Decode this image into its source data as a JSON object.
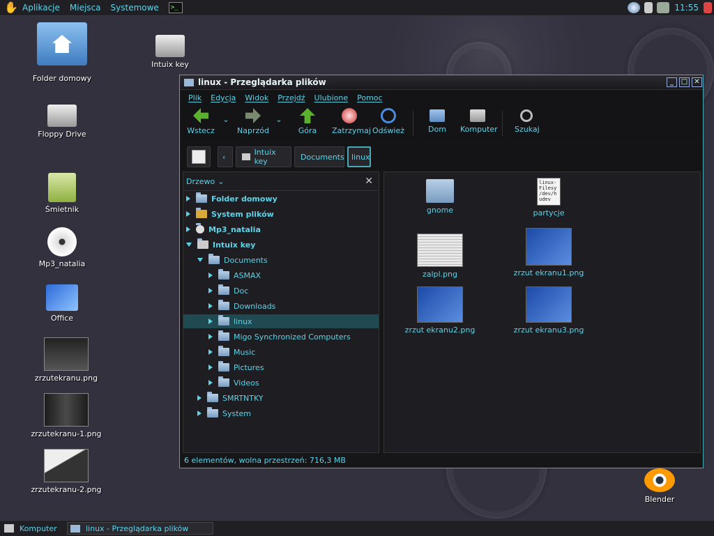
{
  "top_panel": {
    "menus": [
      "Aplikacje",
      "Miejsca",
      "Systemowe"
    ],
    "clock": "11:55",
    "tray_icons": [
      "globe-icon",
      "volume-icon",
      "battery-icon",
      "logout-icon"
    ]
  },
  "desktop_icons": [
    {
      "name": "home-folder",
      "label": "Folder domowy"
    },
    {
      "name": "floppy-drive",
      "label": "Floppy Drive"
    },
    {
      "name": "trash",
      "label": "Śmietnik"
    },
    {
      "name": "cd-mp3",
      "label": "Mp3_natalia"
    },
    {
      "name": "office",
      "label": "Office"
    },
    {
      "name": "screenshot",
      "label": "zrzutekranu.png"
    },
    {
      "name": "screenshot-1",
      "label": "zrzutekranu-1.png"
    },
    {
      "name": "screenshot-2",
      "label": "zrzutekranu-2.png"
    },
    {
      "name": "intuix-key",
      "label": "Intuix key"
    },
    {
      "name": "blender",
      "label": "Blender"
    }
  ],
  "window": {
    "title": "linux - Przeglądarka plików",
    "menu": [
      "Plik",
      "Edycja",
      "Widok",
      "Przejdź",
      "Ulubione",
      "Pomoc"
    ],
    "toolbar": {
      "back": "Wstecz",
      "forward": "Naprzód",
      "up": "Góra",
      "stop": "Zatrzymaj",
      "reload": "Odśwież",
      "home": "Dom",
      "computer": "Komputer",
      "search": "Szukaj"
    },
    "breadcrumbs": [
      "Intuix key",
      "Documents",
      "linux"
    ],
    "sidebar": {
      "mode": "Drzewo",
      "items": [
        {
          "label": "Folder domowy",
          "state": "collapsed"
        },
        {
          "label": "System plików",
          "state": "collapsed"
        },
        {
          "label": "Mp3_natalia",
          "state": "collapsed"
        },
        {
          "label": "Intuix key",
          "state": "expanded"
        },
        {
          "label": "Documents",
          "state": "expanded"
        },
        {
          "label": "ASMAX",
          "state": "collapsed"
        },
        {
          "label": "Doc",
          "state": "collapsed"
        },
        {
          "label": "Downloads",
          "state": "collapsed"
        },
        {
          "label": "linux",
          "state": "collapsed",
          "selected": true
        },
        {
          "label": "Migo Synchronized Computers",
          "state": "collapsed"
        },
        {
          "label": "Music",
          "state": "collapsed"
        },
        {
          "label": "Pictures",
          "state": "collapsed"
        },
        {
          "label": "Videos",
          "state": "collapsed"
        },
        {
          "label": "SMRTNTKY",
          "state": "collapsed"
        },
        {
          "label": "System",
          "state": "collapsed"
        }
      ]
    },
    "files": [
      {
        "label": "gnome",
        "type": "folder"
      },
      {
        "label": "partycje",
        "type": "text",
        "preview": "linux-\nFilesy\n/dev/h\nudev"
      },
      {
        "label": "zalpl.png",
        "type": "image"
      },
      {
        "label": "zrzut ekranu1.png",
        "type": "image"
      },
      {
        "label": "zrzut ekranu2.png",
        "type": "image"
      },
      {
        "label": "zrzut ekranu3.png",
        "type": "image"
      }
    ],
    "status": "6 elementów, wolna przestrzeń: 716,3 MB"
  },
  "taskbar": [
    {
      "label": "Komputer"
    },
    {
      "label": "linux - Przeglądarka plików"
    }
  ]
}
